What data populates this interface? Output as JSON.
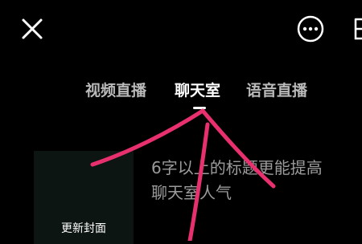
{
  "header": {
    "close_icon": "close-icon",
    "more_icon": "more-icon",
    "flip_icon": "camera-flip-icon"
  },
  "tabs": [
    {
      "label": "视频直播",
      "active": false
    },
    {
      "label": "聊天室",
      "active": true
    },
    {
      "label": "语音直播",
      "active": false
    }
  ],
  "cover": {
    "label": "更新封面"
  },
  "title": {
    "line1": "6字以上的标题更能提高",
    "line2": "聊天室人气"
  },
  "colors": {
    "background": "#000000",
    "annotation": "#e8306f",
    "cover_bg": "#0d1512",
    "muted_text": "#9b9b9b"
  }
}
